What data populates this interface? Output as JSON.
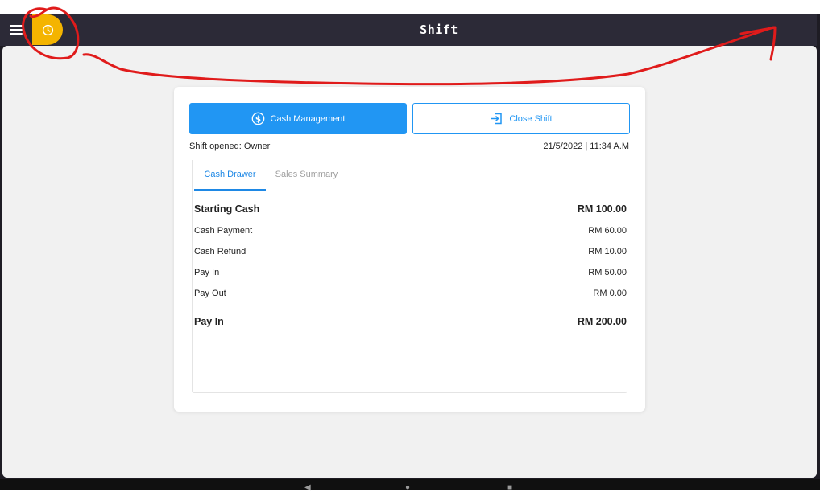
{
  "app": {
    "title": "Shift"
  },
  "icons": {
    "menu": "hamburger-icon",
    "clock": "clock-icon",
    "cash": "dollar-circle-icon",
    "close_shift": "exit-arrow-icon"
  },
  "colors": {
    "accent": "#2196f3",
    "clock_badge": "#f4b400",
    "appbar": "#2c2a37"
  },
  "actions": {
    "cash_management": "Cash Management",
    "close_shift": "Close Shift"
  },
  "shift": {
    "opened_by": "Shift opened: Owner",
    "opened_at": "21/5/2022 | 11:34 A.M"
  },
  "tabs": [
    {
      "label": "Cash Drawer",
      "active": true
    },
    {
      "label": "Sales Summary",
      "active": false
    }
  ],
  "cash_drawer": [
    {
      "label": "Starting Cash",
      "value": "RM 100.00",
      "bold": true
    },
    {
      "label": "Cash Payment",
      "value": "RM 60.00",
      "bold": false
    },
    {
      "label": "Cash Refund",
      "value": "RM 10.00",
      "bold": false
    },
    {
      "label": "Pay In",
      "value": "RM 50.00",
      "bold": false
    },
    {
      "label": "Pay Out",
      "value": "RM 0.00",
      "bold": false
    },
    {
      "label": "Pay In",
      "value": "RM 200.00",
      "bold": true
    }
  ],
  "system_nav": [
    "back",
    "home",
    "recents"
  ]
}
